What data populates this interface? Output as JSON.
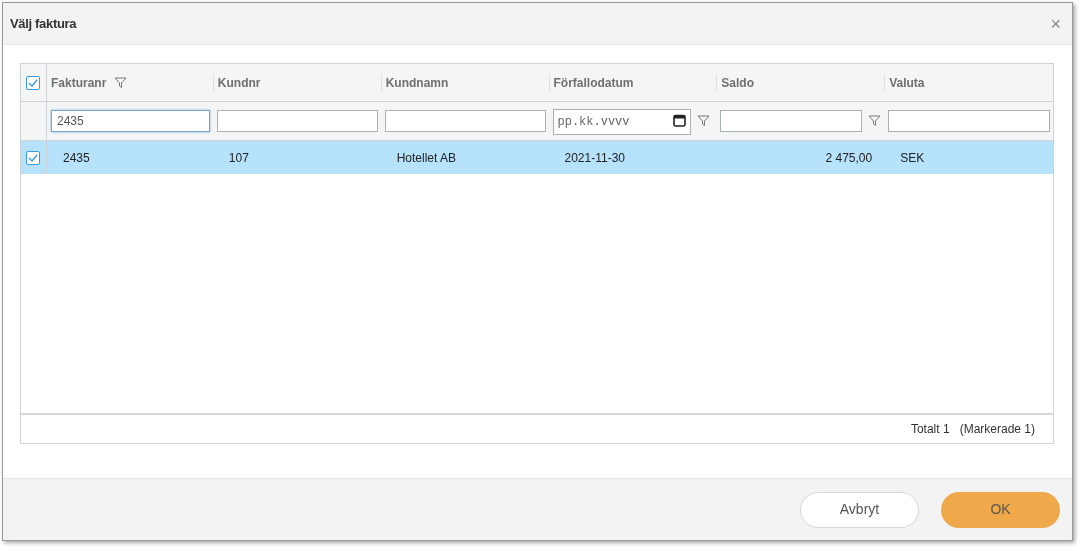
{
  "dialog": {
    "title": "Välj faktura",
    "close": "×"
  },
  "table": {
    "all_checked": true,
    "columns": [
      {
        "label": "Fakturanr",
        "kind": "text",
        "header_funnel": true,
        "filter": {
          "kind": "text",
          "value": "2435",
          "funnel": false,
          "focused": true
        }
      },
      {
        "label": "Kundnr",
        "kind": "text",
        "header_funnel": false,
        "filter": {
          "kind": "text",
          "funnel": false,
          "focused": false
        }
      },
      {
        "label": "Kundnamn",
        "kind": "text",
        "header_funnel": false,
        "filter": {
          "kind": "text",
          "funnel": false,
          "focused": false
        }
      },
      {
        "label": "Förfallodatum",
        "kind": "text",
        "header_funnel": false,
        "filter": {
          "kind": "date",
          "placeholder": "pp.kk.vvvv",
          "funnel": true,
          "focused": false
        }
      },
      {
        "label": "Saldo",
        "kind": "amount",
        "header_funnel": false,
        "filter": {
          "kind": "text",
          "funnel": true,
          "focused": false
        }
      },
      {
        "label": "Valuta",
        "kind": "text",
        "header_funnel": false,
        "filter": {
          "kind": "text",
          "funnel": false,
          "focused": false
        }
      }
    ],
    "rows": [
      {
        "selected": true,
        "cells": [
          "2435",
          "107",
          "Hotellet AB",
          "2021-11-30",
          "2 475,00",
          "SEK"
        ]
      }
    ]
  },
  "footer": {
    "total": "Totalt 1",
    "marked": "(Markerade 1)"
  },
  "buttons": [
    {
      "label": "Avbryt",
      "kind": "secondary"
    },
    {
      "label": "OK",
      "kind": "primary"
    }
  ]
}
